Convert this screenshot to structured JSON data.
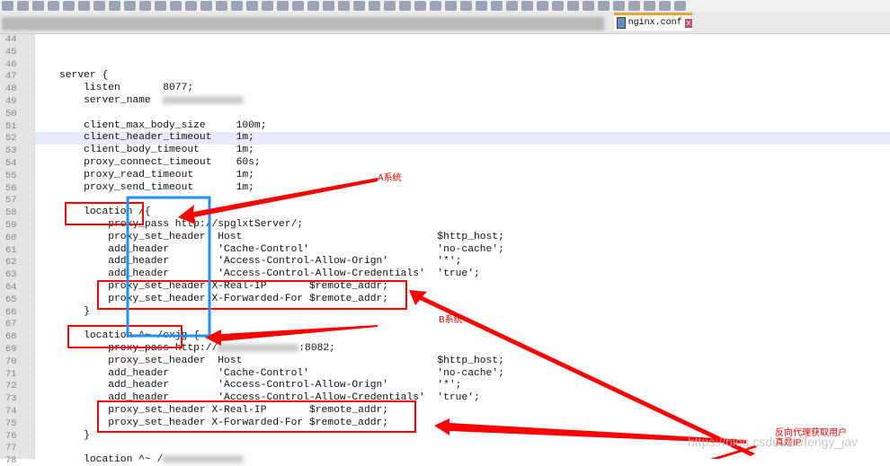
{
  "tab": {
    "filename": "nginx.conf",
    "close": "x"
  },
  "lines": [
    {
      "n": "44",
      "t": ""
    },
    {
      "n": "45",
      "t": ""
    },
    {
      "n": "46",
      "t": ""
    },
    {
      "n": "47",
      "t": "server {"
    },
    {
      "n": "48",
      "t": "    listen       8077;"
    },
    {
      "n": "49",
      "t": "    server_name  ",
      "blur": true
    },
    {
      "n": "50",
      "t": ""
    },
    {
      "n": "51",
      "t": "    client_max_body_size     100m;"
    },
    {
      "n": "52",
      "t": "    client_header_timeout    1m;"
    },
    {
      "n": "53",
      "t": "    client_body_timeout      1m;"
    },
    {
      "n": "54",
      "t": "    proxy_connect_timeout    60s;"
    },
    {
      "n": "55",
      "t": "    proxy_read_timeout       1m;"
    },
    {
      "n": "56",
      "t": "    proxy_send_timeout       1m;"
    },
    {
      "n": "57",
      "t": ""
    },
    {
      "n": "58",
      "t": "    location /{"
    },
    {
      "n": "59",
      "t": "        proxy_pass http://spglxtServer/;"
    },
    {
      "n": "60",
      "t": "        proxy_set_header  Host                                $http_host;"
    },
    {
      "n": "61",
      "t": "        add_header        'Cache-Control'                     'no-cache';"
    },
    {
      "n": "62",
      "t": "        add_header        'Access-Control-Allow-Orign'        '*';"
    },
    {
      "n": "63",
      "t": "        add_header        'Access-Control-Allow-Credentials'  'true';"
    },
    {
      "n": "64",
      "t": "        proxy_set_header X-Real-IP       $remote_addr;"
    },
    {
      "n": "65",
      "t": "        proxy_set_header X-Forwarded-For $remote_addr;"
    },
    {
      "n": "66",
      "t": "    }"
    },
    {
      "n": "67",
      "t": ""
    },
    {
      "n": "68",
      "t": "    location ^~ /cxjg {"
    },
    {
      "n": "69",
      "t": "        proxy_pass http://",
      "blur": true,
      "after": ":8082;"
    },
    {
      "n": "70",
      "t": "        proxy_set_header  Host                                $http_host;"
    },
    {
      "n": "71",
      "t": "        add_header        'Cache-Control'                     'no-cache';"
    },
    {
      "n": "72",
      "t": "        add_header        'Access-Control-Allow-Orign'        '*';"
    },
    {
      "n": "73",
      "t": "        add_header        'Access-Control-Allow-Credentials'  'true';"
    },
    {
      "n": "74",
      "t": "        proxy_set_header X-Real-IP       $remote_addr;"
    },
    {
      "n": "75",
      "t": "        proxy_set_header X-Forwarded-For $remote_addr;"
    },
    {
      "n": "76",
      "t": "    }"
    },
    {
      "n": "77",
      "t": ""
    },
    {
      "n": "78",
      "t": "    location ^~ /",
      "blur": true
    }
  ],
  "annotations": {
    "a": "A系统",
    "b": "B系统",
    "note1": "反向代理获取用户",
    "note2": "真是IP"
  },
  "watermark": "https://blog.csdn.net/fengy_jav",
  "colors": {
    "annotation": "#ff0000",
    "box_blue": "#1e90ff",
    "current_line": "#e8e8ff"
  }
}
